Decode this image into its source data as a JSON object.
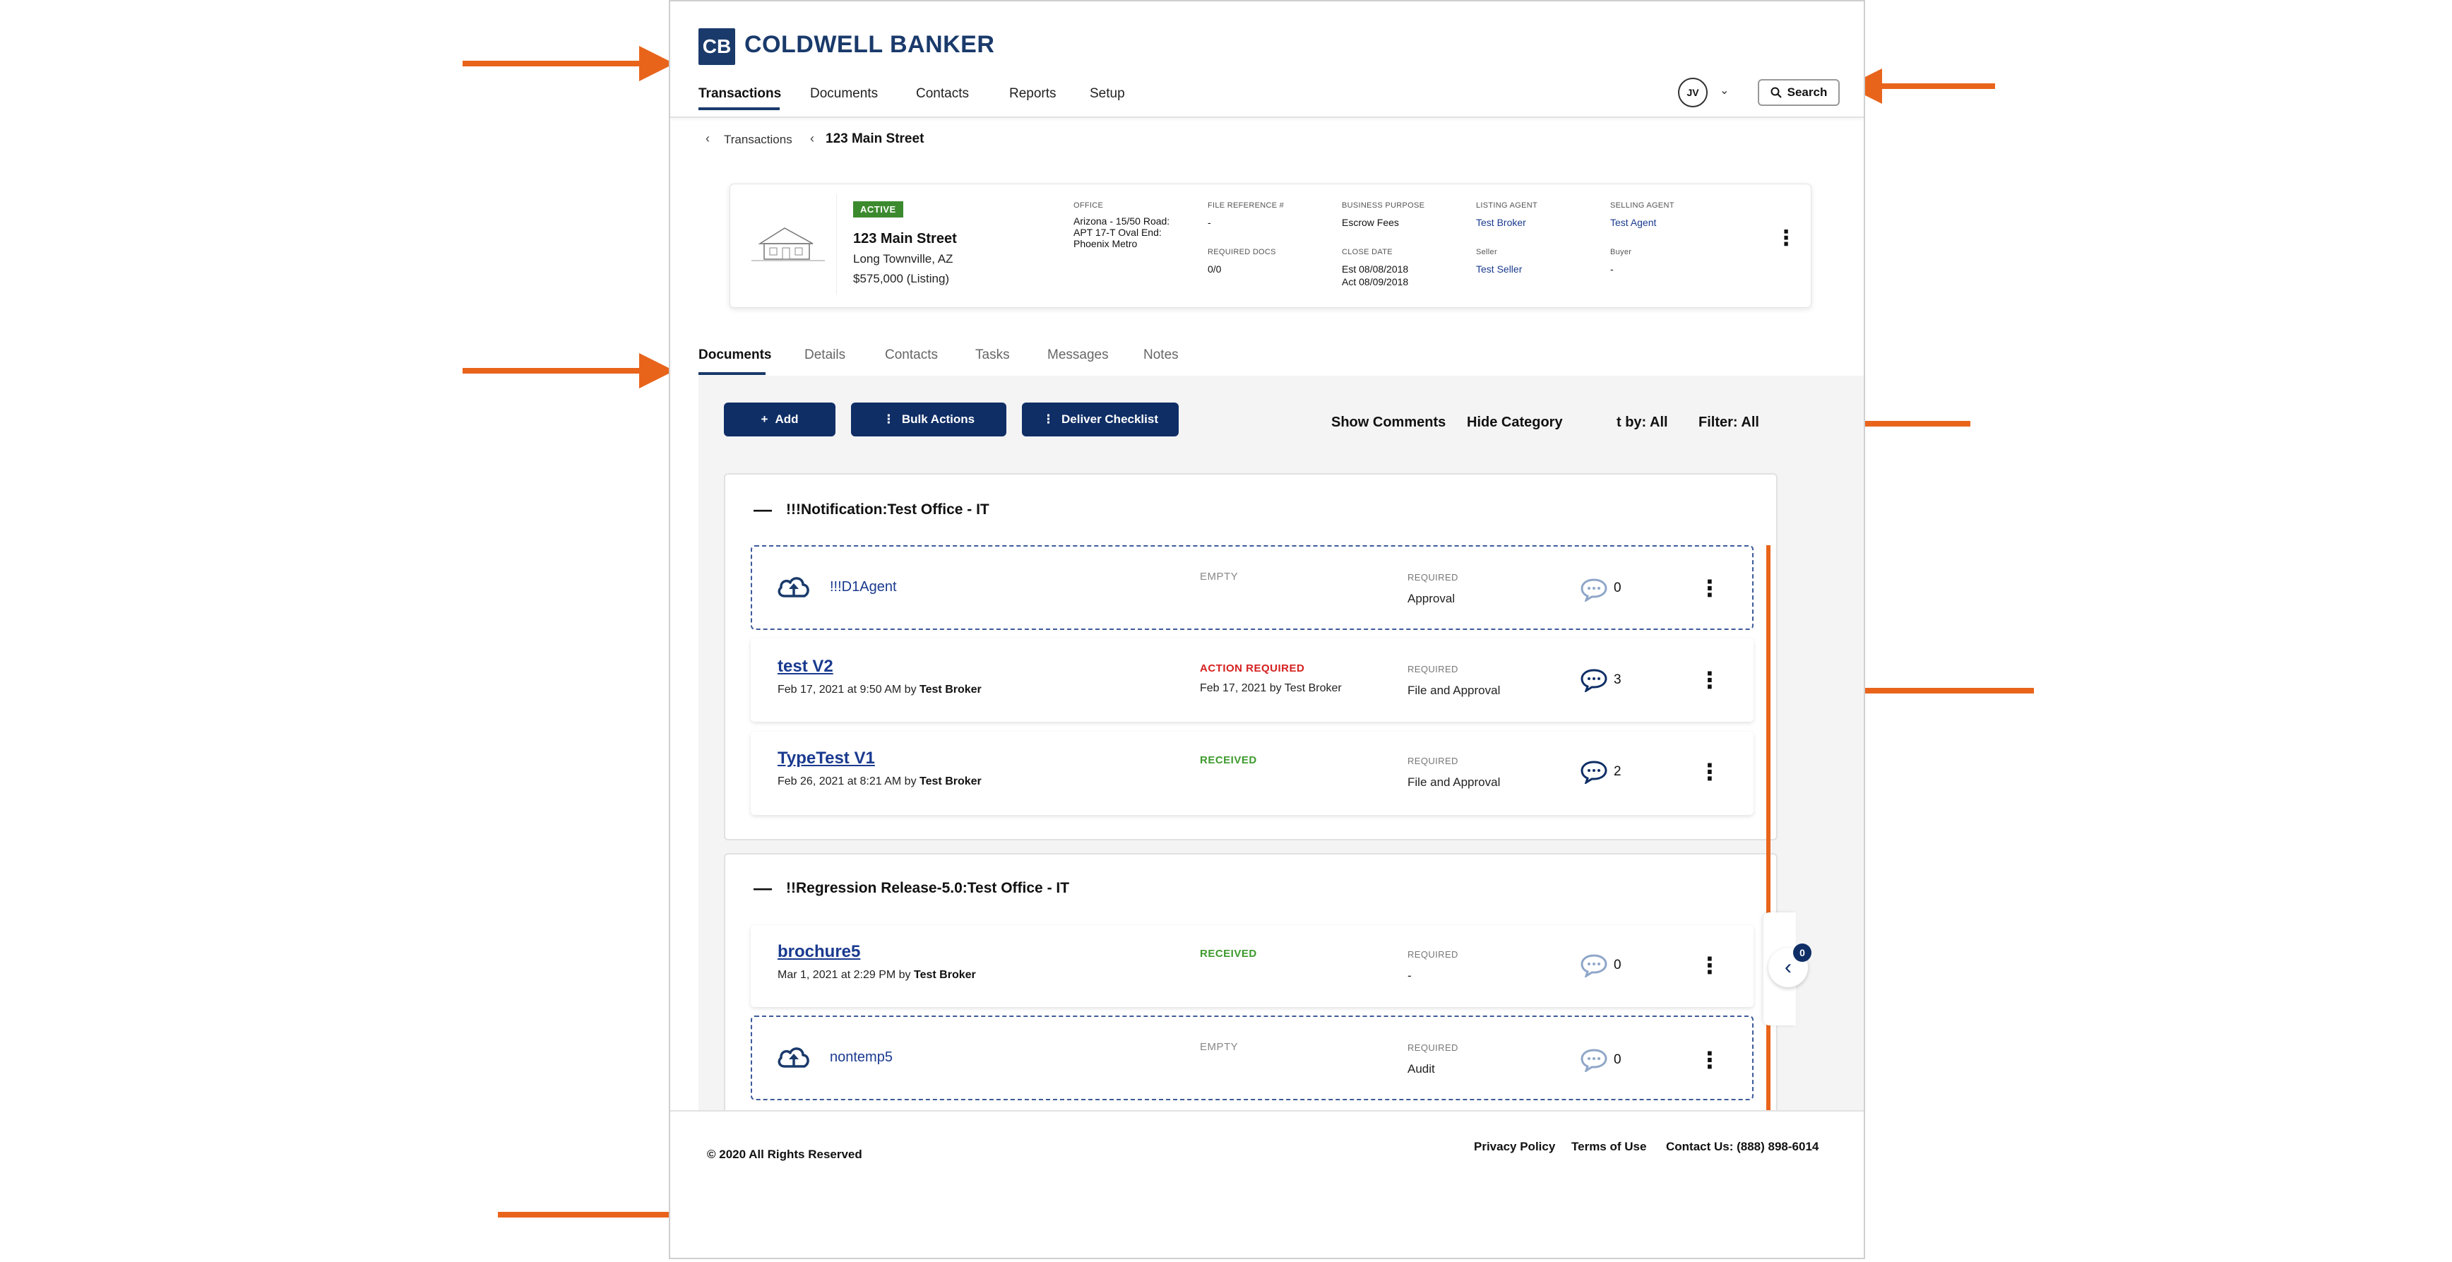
{
  "brand": {
    "logo_mark": "CB",
    "name": "COLDWELL BANKER"
  },
  "nav": {
    "items": [
      {
        "label": "Transactions",
        "active": true
      },
      {
        "label": "Documents"
      },
      {
        "label": "Contacts"
      },
      {
        "label": "Reports"
      },
      {
        "label": "Setup"
      }
    ]
  },
  "user": {
    "initials": "JV"
  },
  "search": {
    "label": "Search"
  },
  "breadcrumb": {
    "parent": "Transactions",
    "current": "123 Main Street"
  },
  "property": {
    "status": "ACTIVE",
    "address_line1": "123 Main Street",
    "address_line2": "Long Townville, AZ",
    "price": "$575,000 (Listing)",
    "office_label": "OFFICE",
    "office_value": "Arizona - 15/50 Road: APT 17-T Oval End: Phoenix Metro",
    "file_ref_label": "FILE REFERENCE #",
    "file_ref_value": "-",
    "required_docs_label": "REQUIRED DOCS",
    "required_docs_value": "0/0",
    "business_purpose_label": "BUSINESS PURPOSE",
    "business_purpose_value": "Escrow Fees",
    "close_date_label": "CLOSE DATE",
    "close_date_est": "Est 08/08/2018",
    "close_date_act": "Act 08/09/2018",
    "listing_agent_label": "LISTING AGENT",
    "listing_agent_value": "Test Broker",
    "seller_label": "Seller",
    "seller_value": "Test Seller",
    "selling_agent_label": "SELLING AGENT",
    "selling_agent_value": "Test Agent",
    "buyer_label": "Buyer",
    "buyer_value": "-"
  },
  "tabs": [
    {
      "label": "Documents",
      "active": true
    },
    {
      "label": "Details"
    },
    {
      "label": "Contacts"
    },
    {
      "label": "Tasks"
    },
    {
      "label": "Messages"
    },
    {
      "label": "Notes"
    }
  ],
  "toolbar": {
    "add": "Add",
    "bulk_actions": "Bulk Actions",
    "deliver_checklist": "Deliver Checklist",
    "show_comments": "Show Comments",
    "hide_category": "Hide Category",
    "sort_by": "t by: All",
    "filter": "Filter: All"
  },
  "groups": [
    {
      "title": "!!!Notification:Test Office - IT",
      "rows": [
        {
          "name": "!!!D1Agent",
          "empty": true,
          "status": "EMPTY",
          "status_sub": "",
          "required_label": "REQUIRED",
          "required_value": "Approval",
          "comments": "0",
          "meta_date": "",
          "meta_by": ""
        },
        {
          "name": "test V2",
          "empty": false,
          "status": "ACTION REQUIRED",
          "status_sub": "Feb 17, 2021 by Test Broker",
          "required_label": "REQUIRED",
          "required_value": "File and Approval",
          "comments": "3",
          "meta_date": "Feb 17, 2021 at 9:50 AM by ",
          "meta_by": "Test Broker"
        },
        {
          "name": "TypeTest V1",
          "empty": false,
          "status": "RECEIVED",
          "status_sub": "",
          "required_label": "REQUIRED",
          "required_value": "File and Approval",
          "comments": "2",
          "meta_date": "Feb 26, 2021 at 8:21 AM by ",
          "meta_by": "Test Broker"
        }
      ]
    },
    {
      "title": "!!Regression Release-5.0:Test Office - IT",
      "rows": [
        {
          "name": "brochure5",
          "empty": false,
          "status": "RECEIVED",
          "status_sub": "",
          "required_label": "REQUIRED",
          "required_value": "-",
          "comments": "0",
          "meta_date": "Mar 1, 2021 at 2:29 PM by ",
          "meta_by": "Test Broker"
        },
        {
          "name": "nontemp5",
          "empty": true,
          "status": "EMPTY",
          "status_sub": "",
          "required_label": "REQUIRED",
          "required_value": "Audit",
          "comments": "0",
          "meta_date": "",
          "meta_by": ""
        }
      ]
    }
  ],
  "side_panel": {
    "badge": "0"
  },
  "footer": {
    "copyright": "© 2020 All Rights Reserved",
    "privacy": "Privacy Policy",
    "terms": "Terms of Use",
    "contact": "Contact Us: (888) 898-6014"
  },
  "colors": {
    "brand_navy": "#1a3a6b",
    "button_navy": "#0f2e66",
    "annotation_arrow": "#e8641b",
    "status_action": "#d62020",
    "status_received": "#3d9a2d",
    "status_active_badge": "#3c8a2e"
  }
}
